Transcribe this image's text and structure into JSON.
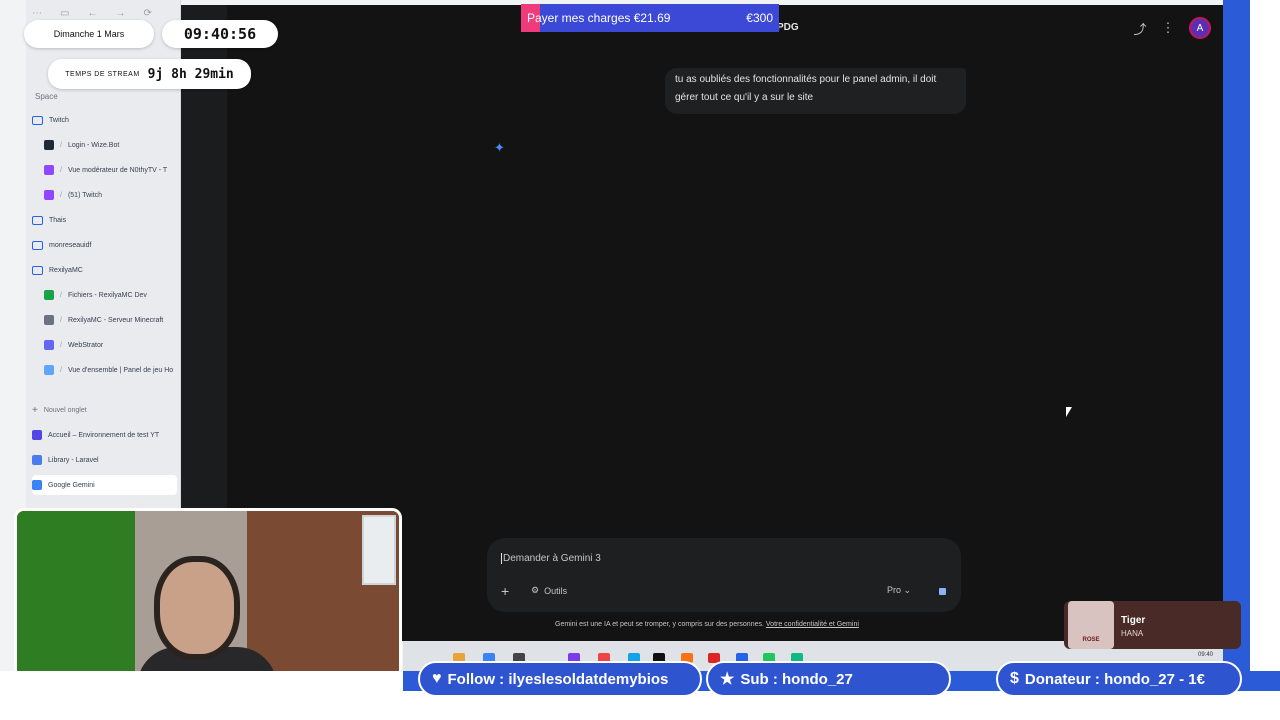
{
  "overlay": {
    "date": "Dimanche 1 Mars",
    "clock": "09:40:56",
    "stream_label": "TEMPS DE STREAM",
    "stream_time": "9j 8h 29min",
    "goal": {
      "label": "Payer mes charges €21.69",
      "target": "€300",
      "progress": 0.072
    }
  },
  "sidebar": {
    "section_label": "Space",
    "items": [
      {
        "label": "Twitch",
        "type": "folder"
      },
      {
        "label": "Login - Wize.Bot",
        "type": "child",
        "icon": "wizebot",
        "color": "#1f2937"
      },
      {
        "label": "Vue modérateur de N0thyTV - T",
        "type": "child",
        "icon": "twitch",
        "color": "#9146ff"
      },
      {
        "label": "(51) Twitch",
        "type": "child",
        "icon": "twitch",
        "color": "#9146ff"
      },
      {
        "label": "Thais",
        "type": "folder"
      },
      {
        "label": "monreseauidf",
        "type": "folder"
      },
      {
        "label": "RexilyaMC",
        "type": "folder"
      },
      {
        "label": "Fichiers - RexilyaMC Dev",
        "type": "child",
        "icon": "s",
        "color": "#16a34a"
      },
      {
        "label": "RexilyaMC - Serveur Minecraft",
        "type": "child",
        "icon": "mc",
        "color": "#6b7280"
      },
      {
        "label": "WebStrator",
        "type": "child",
        "icon": "webstrator",
        "color": "#6366f1"
      },
      {
        "label": "Vue d'ensemble | Panel de jeu Ho",
        "type": "child",
        "icon": "cloud",
        "color": "#60a5fa"
      },
      {
        "label": "Nouvel onglet",
        "type": "new"
      },
      {
        "label": "Accueil – Environnement de test YT",
        "type": "tab",
        "icon": "yt",
        "color": "#4f46e5"
      },
      {
        "label": "Library - Laravel",
        "type": "tab",
        "icon": "laravel",
        "color": "#4b7bec"
      },
      {
        "label": "Google Gemini",
        "type": "tab-active",
        "icon": "gemini",
        "color": "#3b82f6"
      }
    ]
  },
  "gemini": {
    "title_fragment": "PDG",
    "avatar_letter": "A",
    "user_message": "tu as oubliés des fonctionnalités pour le panel admin, il doit gérer tout ce qu'il y a sur le site",
    "prompt_placeholder": "Demander à Gemini 3",
    "tools_label": "Outils",
    "model_label": "Pro",
    "disclaimer": "Gemini est une IA et peut se tromper, y compris sur des personnes.",
    "privacy_link": "Votre confidentialité et Gemini"
  },
  "music": {
    "title": "Tiger",
    "artist": "HANA",
    "art_text": "ROSE"
  },
  "alerts": {
    "follow": "Follow : ilyeslesoldatdemybios",
    "sub": "Sub : hondo_27",
    "donor": "Donateur : hondo_27 - 1€"
  },
  "taskbar": {
    "time": "09:40"
  }
}
